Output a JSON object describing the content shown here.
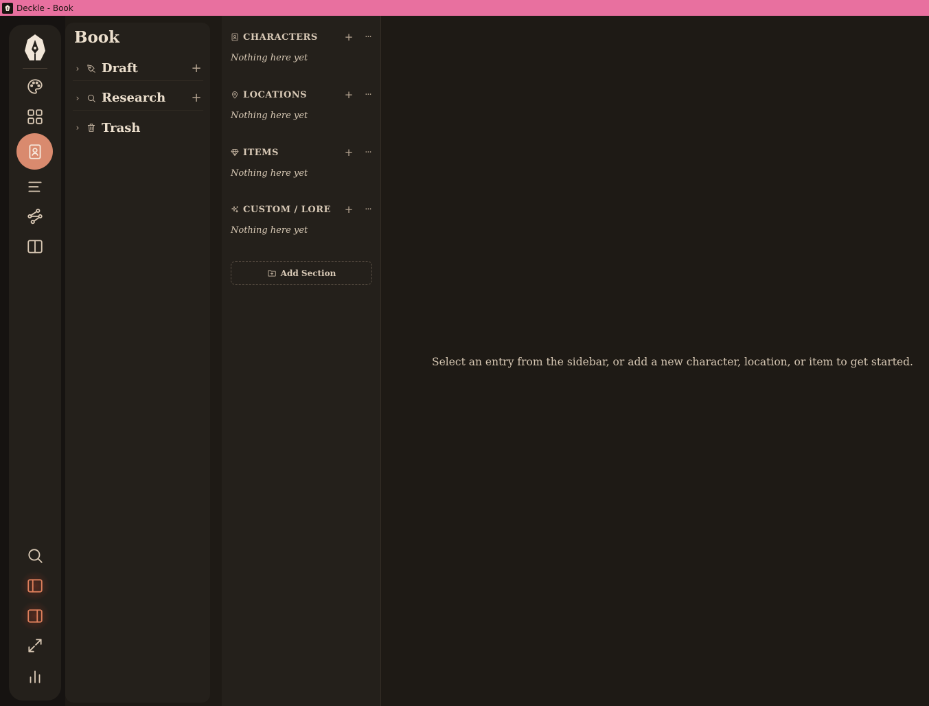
{
  "window": {
    "title": "Deckle - Book"
  },
  "rail": {
    "top_items": [
      {
        "name": "palette-icon"
      },
      {
        "name": "grid-icon"
      },
      {
        "name": "contact-book-icon",
        "active": true
      },
      {
        "name": "outline-icon"
      },
      {
        "name": "timeline-icon"
      },
      {
        "name": "columns-icon"
      }
    ],
    "bottom_items": [
      {
        "name": "search-icon"
      },
      {
        "name": "left-panel-icon"
      },
      {
        "name": "right-panel-icon"
      },
      {
        "name": "expand-icon"
      },
      {
        "name": "stats-icon"
      }
    ]
  },
  "binder": {
    "title": "Book",
    "items": [
      {
        "label": "Draft",
        "icon": "pen-nib-icon",
        "addable": true
      },
      {
        "label": "Research",
        "icon": "search-icon",
        "addable": true
      },
      {
        "label": "Trash",
        "icon": "trash-icon",
        "addable": false
      }
    ]
  },
  "codex": {
    "sections": [
      {
        "name": "CHARACTERS",
        "icon": "contact-icon",
        "empty_text": "Nothing here yet"
      },
      {
        "name": "LOCATIONS",
        "icon": "map-pin-icon",
        "empty_text": "Nothing here yet"
      },
      {
        "name": "ITEMS",
        "icon": "gem-icon",
        "empty_text": "Nothing here yet"
      },
      {
        "name": "CUSTOM / LORE",
        "icon": "sparkles-icon",
        "empty_text": "Nothing here yet"
      }
    ],
    "add_section_label": "Add Section",
    "add_symbol": "+",
    "more_symbol": "···"
  },
  "main": {
    "empty_message": "Select an entry from the sidebar, or add a new character, location, or item to get started."
  },
  "colors": {
    "titlebar": "#e8709f",
    "accent": "#d98a6e",
    "background": "#1e1a15",
    "panel": "#24201b"
  }
}
